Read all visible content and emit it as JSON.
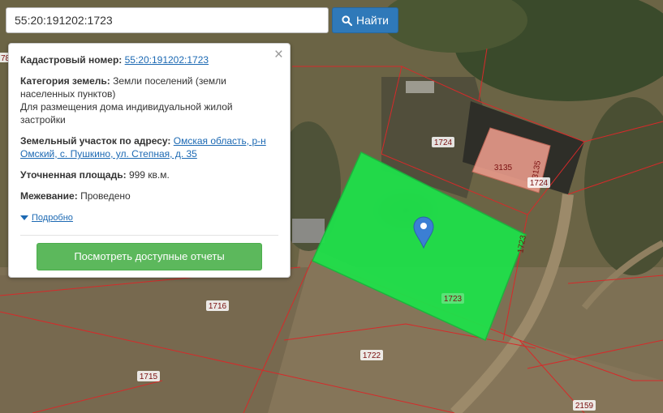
{
  "search": {
    "value": "55:20:191202:1723",
    "button_label": "Найти"
  },
  "panel": {
    "cadastral_label": "Кадастровый номер:",
    "cadastral_value": "55:20:191202:1723",
    "category_label": "Категория земель:",
    "category_value": "Земли поселений (земли населенных пунктов)",
    "usage_value": "Для размещения дома индивидуальной жилой застройки",
    "address_label": "Земельный участок по адресу:",
    "address_value": "Омская область, р-н Омский, с. Пушкино, ул. Степная, д. 35",
    "area_label": "Уточненная площадь:",
    "area_value": "999 кв.м.",
    "survey_label": "Межевание:",
    "survey_value": "Проведено",
    "details_label": "Подробно",
    "reports_button": "Посмотреть доступные отчеты",
    "close_symbol": "×"
  },
  "map": {
    "labels": {
      "plot_1724_top": "1724",
      "plot_3135": "3135",
      "plot_3135_vertical": "3135",
      "plot_1724_right": "1724",
      "plot_1723": "1723",
      "plot_1723_edge": "1723",
      "plot_1716": "1716",
      "plot_1722": "1722",
      "plot_1715": "1715",
      "plot_2159": "2159",
      "plot_edge_left": "78"
    },
    "colors": {
      "selected_parcel": "#1fe04a",
      "parcel_border": "#d62a2a",
      "building": "#e89a8a",
      "marker": "#3b7fd4"
    }
  }
}
